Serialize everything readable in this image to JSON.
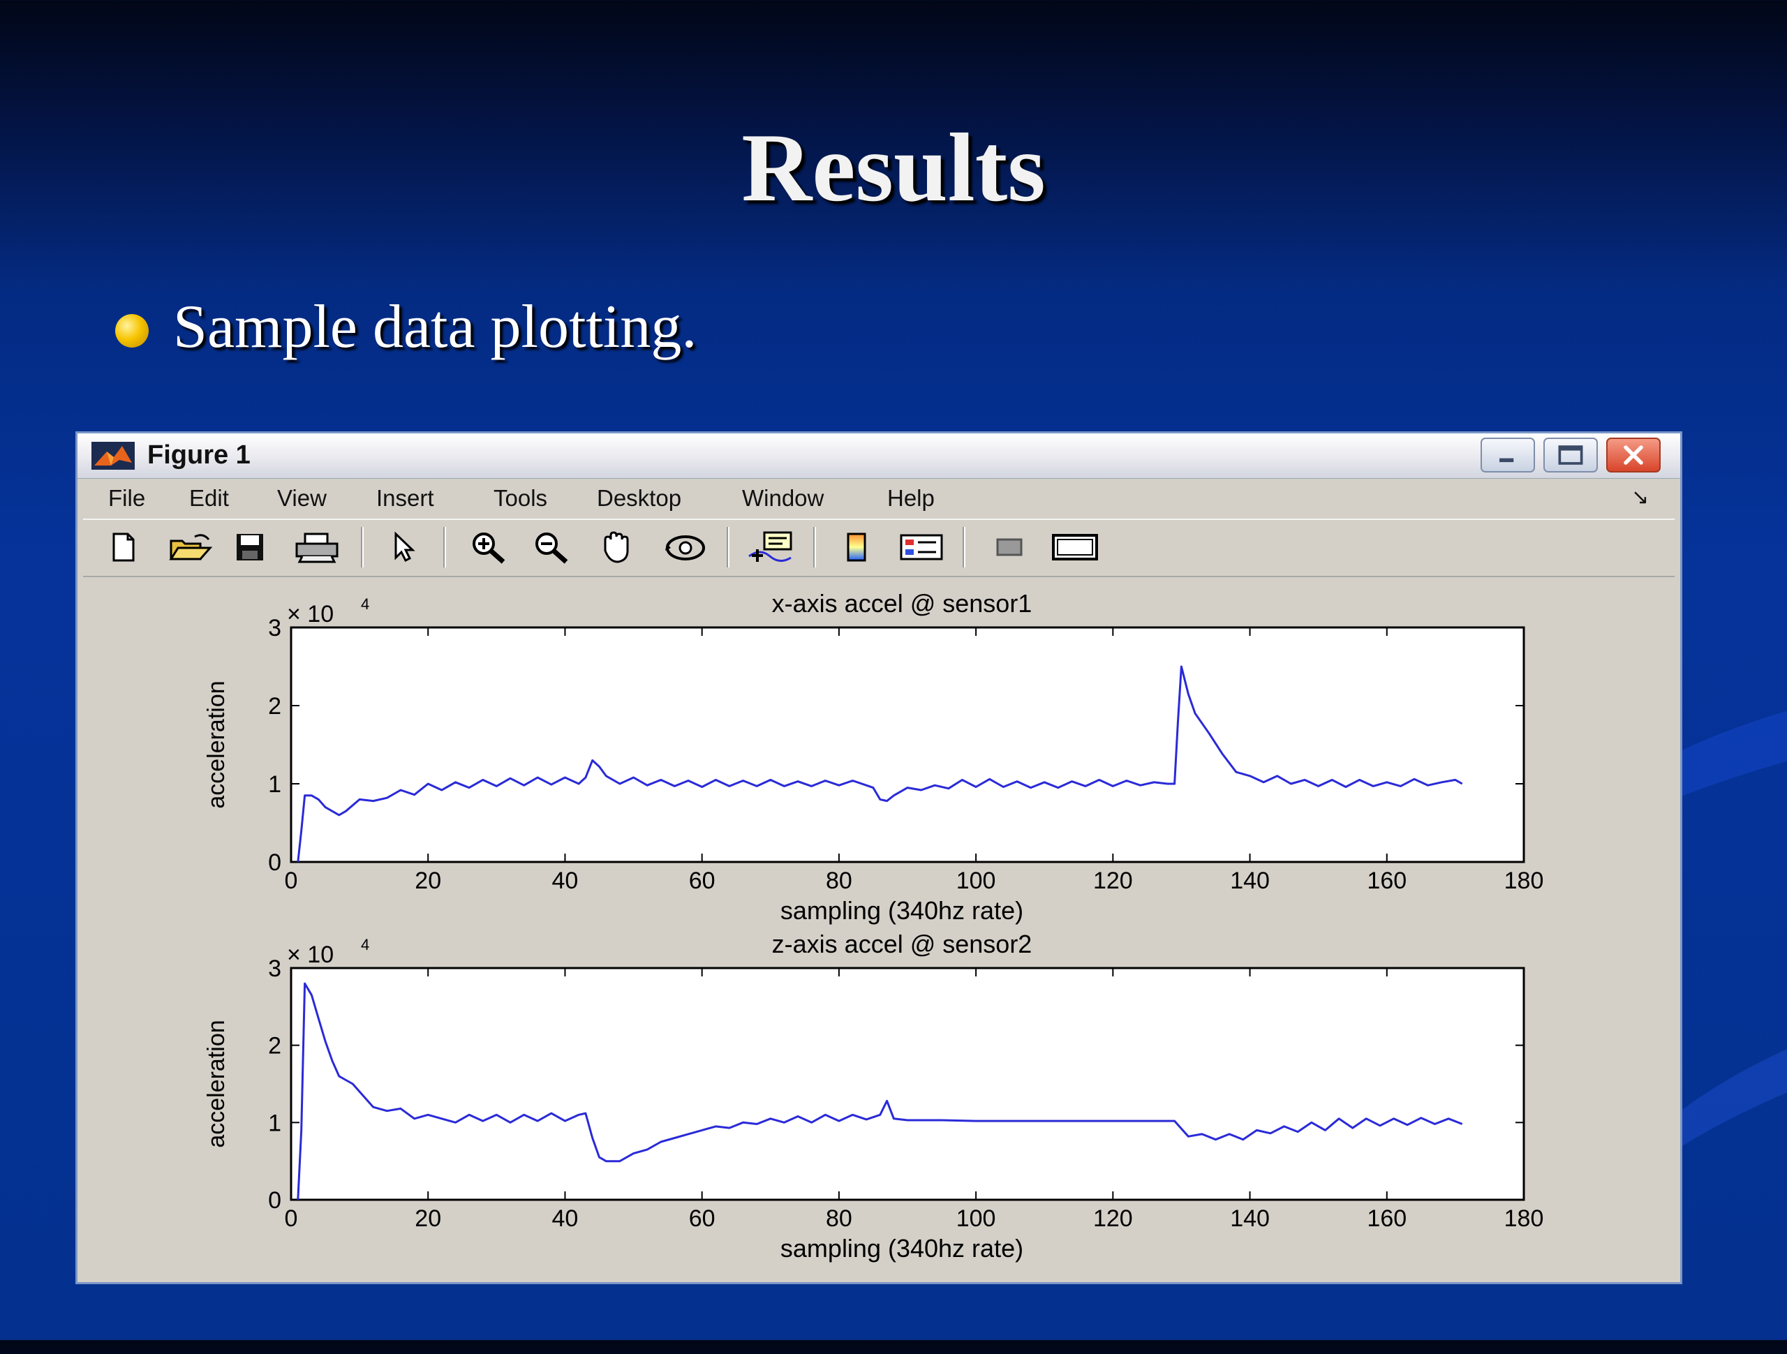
{
  "slide": {
    "title": "Results",
    "bullet": "Sample data plotting."
  },
  "window": {
    "title": "Figure 1",
    "menu": [
      "File",
      "Edit",
      "View",
      "Insert",
      "Tools",
      "Desktop",
      "Window",
      "Help"
    ]
  },
  "toolbar": [
    {
      "name": "new-figure-icon"
    },
    {
      "name": "open-file-icon"
    },
    {
      "name": "save-icon"
    },
    {
      "name": "print-icon"
    },
    {
      "name": "edit-plot-arrow-icon"
    },
    {
      "name": "zoom-in-icon"
    },
    {
      "name": "zoom-out-icon"
    },
    {
      "name": "pan-hand-icon"
    },
    {
      "name": "rotate-3d-icon"
    },
    {
      "name": "data-cursor-icon"
    },
    {
      "name": "insert-colorbar-icon"
    },
    {
      "name": "insert-legend-icon"
    },
    {
      "name": "hide-plot-tools-icon"
    },
    {
      "name": "show-plot-tools-icon"
    }
  ],
  "colors": {
    "line": "#2a2ad8",
    "figure_bg": "#d4d0c8"
  },
  "chart_data": [
    {
      "type": "line",
      "title": "x-axis accel @ sensor1",
      "xlabel": "sampling (340hz rate)",
      "ylabel": "acceleration",
      "scale_label": "× 10",
      "scale_exponent": "4",
      "xlim": [
        0,
        180
      ],
      "ylim": [
        0,
        3
      ],
      "xticks": [
        0,
        20,
        40,
        60,
        80,
        100,
        120,
        140,
        160,
        180
      ],
      "yticks": [
        0,
        1,
        2,
        3
      ],
      "series": [
        {
          "x": [
            1,
            1.5,
            2,
            3,
            4,
            5,
            6,
            7,
            8,
            10,
            12,
            14,
            16,
            18,
            20,
            22,
            24,
            26,
            28,
            30,
            32,
            34,
            36,
            38,
            40,
            42,
            43,
            44,
            45,
            46,
            48,
            50,
            52,
            54,
            56,
            58,
            60,
            62,
            64,
            66,
            68,
            70,
            72,
            74,
            76,
            78,
            80,
            82,
            84,
            85,
            86,
            87,
            88,
            90,
            92,
            94,
            96,
            98,
            100,
            102,
            104,
            106,
            108,
            110,
            112,
            114,
            116,
            118,
            120,
            122,
            124,
            126,
            128,
            129,
            129.5,
            130,
            131,
            132,
            134,
            136,
            138,
            140,
            142,
            144,
            146,
            148,
            150,
            152,
            154,
            156,
            158,
            160,
            162,
            164,
            166,
            168,
            170,
            171
          ],
          "y": [
            0,
            0.4,
            0.85,
            0.85,
            0.8,
            0.7,
            0.65,
            0.6,
            0.65,
            0.8,
            0.78,
            0.82,
            0.92,
            0.86,
            1.0,
            0.92,
            1.02,
            0.95,
            1.05,
            0.97,
            1.07,
            0.98,
            1.08,
            0.99,
            1.08,
            1.0,
            1.08,
            1.3,
            1.22,
            1.1,
            1.0,
            1.08,
            0.98,
            1.05,
            0.97,
            1.04,
            0.96,
            1.05,
            0.97,
            1.04,
            0.97,
            1.05,
            0.97,
            1.03,
            0.97,
            1.04,
            0.98,
            1.04,
            0.98,
            0.95,
            0.8,
            0.78,
            0.85,
            0.95,
            0.92,
            0.98,
            0.94,
            1.05,
            0.96,
            1.06,
            0.96,
            1.03,
            0.95,
            1.02,
            0.95,
            1.03,
            0.97,
            1.05,
            0.97,
            1.04,
            0.98,
            1.02,
            1.0,
            1.0,
            1.8,
            2.5,
            2.15,
            1.9,
            1.65,
            1.38,
            1.15,
            1.1,
            1.02,
            1.1,
            1.0,
            1.05,
            0.97,
            1.05,
            0.96,
            1.05,
            0.97,
            1.02,
            0.97,
            1.06,
            0.98,
            1.02,
            1.05,
            1.0
          ]
        }
      ]
    },
    {
      "type": "line",
      "title": "z-axis accel @ sensor2",
      "xlabel": "sampling (340hz rate)",
      "ylabel": "acceleration",
      "scale_label": "× 10",
      "scale_exponent": "4",
      "xlim": [
        0,
        180
      ],
      "ylim": [
        0,
        3
      ],
      "xticks": [
        0,
        20,
        40,
        60,
        80,
        100,
        120,
        140,
        160,
        180
      ],
      "yticks": [
        0,
        1,
        2,
        3
      ],
      "series": [
        {
          "x": [
            1,
            1.5,
            2,
            3,
            4,
            5,
            6,
            7,
            8,
            9,
            10,
            12,
            14,
            16,
            18,
            20,
            22,
            24,
            26,
            28,
            30,
            32,
            34,
            36,
            38,
            40,
            42,
            43,
            44,
            45,
            46,
            48,
            50,
            52,
            54,
            56,
            58,
            60,
            62,
            64,
            66,
            68,
            70,
            72,
            74,
            76,
            78,
            80,
            82,
            84,
            86,
            87,
            88,
            90,
            95,
            100,
            105,
            110,
            115,
            120,
            125,
            129,
            131,
            133,
            135,
            137,
            139,
            141,
            143,
            145,
            147,
            149,
            151,
            153,
            155,
            157,
            159,
            161,
            163,
            165,
            167,
            169,
            171
          ],
          "y": [
            0,
            0.9,
            2.8,
            2.65,
            2.35,
            2.05,
            1.8,
            1.6,
            1.55,
            1.5,
            1.4,
            1.2,
            1.15,
            1.18,
            1.05,
            1.1,
            1.05,
            1.0,
            1.1,
            1.02,
            1.1,
            1.0,
            1.1,
            1.02,
            1.12,
            1.02,
            1.1,
            1.12,
            0.8,
            0.55,
            0.5,
            0.5,
            0.6,
            0.65,
            0.75,
            0.8,
            0.85,
            0.9,
            0.95,
            0.93,
            1.0,
            0.98,
            1.05,
            1.0,
            1.08,
            1.0,
            1.1,
            1.02,
            1.1,
            1.04,
            1.1,
            1.28,
            1.05,
            1.03,
            1.03,
            1.02,
            1.02,
            1.02,
            1.02,
            1.02,
            1.02,
            1.02,
            0.82,
            0.85,
            0.78,
            0.85,
            0.78,
            0.9,
            0.86,
            0.95,
            0.88,
            1.0,
            0.9,
            1.05,
            0.93,
            1.05,
            0.96,
            1.05,
            0.97,
            1.06,
            0.98,
            1.05,
            0.98
          ]
        }
      ]
    }
  ]
}
